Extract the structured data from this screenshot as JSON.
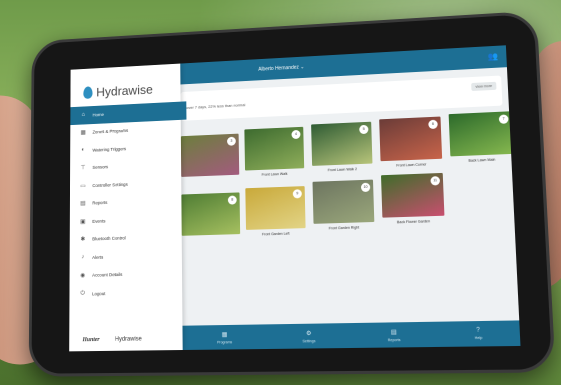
{
  "app": {
    "name": "Hydrawise",
    "user": "Alberto Hernandez"
  },
  "banner": {
    "text": "over 7 days, 22% less than normal",
    "chip": "view more"
  },
  "nav": [
    {
      "label": "Home",
      "icon": "home-icon"
    },
    {
      "label": "Zones & Programs",
      "icon": "grid-icon"
    },
    {
      "label": "Watering Triggers",
      "icon": "toggle-icon"
    },
    {
      "label": "Sensors",
      "icon": "sensor-icon"
    },
    {
      "label": "Controller Settings",
      "icon": "controller-icon"
    },
    {
      "label": "Reports",
      "icon": "reports-icon"
    },
    {
      "label": "Events",
      "icon": "calendar-icon"
    },
    {
      "label": "Bluetooth Control",
      "icon": "bluetooth-icon"
    },
    {
      "label": "Alerts",
      "icon": "bell-icon"
    },
    {
      "label": "Account Details",
      "icon": "user-icon"
    },
    {
      "label": "Logout",
      "icon": "power-icon"
    }
  ],
  "brands": {
    "hunter": "Hunter",
    "hydrawise": "Hydrawise"
  },
  "zones": [
    {
      "name": "",
      "badge": "3",
      "color1": "#6c7e3d",
      "color2": "#a35b7e"
    },
    {
      "name": "Front Lawn Walk",
      "badge": "4",
      "color1": "#3d6b2f",
      "color2": "#8fae5a"
    },
    {
      "name": "Front Lawn Walk 2",
      "badge": "5",
      "color1": "#2f5c34",
      "color2": "#b7c47a"
    },
    {
      "name": "Front Lawn Corner",
      "badge": "6",
      "color1": "#6b3c38",
      "color2": "#c8644a"
    },
    {
      "name": "Back Lawn Main",
      "badge": "7",
      "color1": "#2c6a2b",
      "color2": "#86b84f"
    },
    {
      "name": "",
      "badge": "8",
      "color1": "#4f7d34",
      "color2": "#a6c060"
    },
    {
      "name": "Front Garden Left",
      "badge": "9",
      "color1": "#c9a93a",
      "color2": "#e2d486"
    },
    {
      "name": "Front Garden Right",
      "badge": "10",
      "color1": "#6d7560",
      "color2": "#9aa77b"
    },
    {
      "name": "Back Flower Garden",
      "badge": "11",
      "color1": "#3f6d2a",
      "color2": "#c84f6f"
    }
  ],
  "bottom_tabs": [
    {
      "label": "Programs",
      "icon": "programs-icon"
    },
    {
      "label": "Settings",
      "icon": "settings-icon"
    },
    {
      "label": "Reports",
      "icon": "reports-icon"
    },
    {
      "label": "Help",
      "icon": "help-icon"
    }
  ]
}
